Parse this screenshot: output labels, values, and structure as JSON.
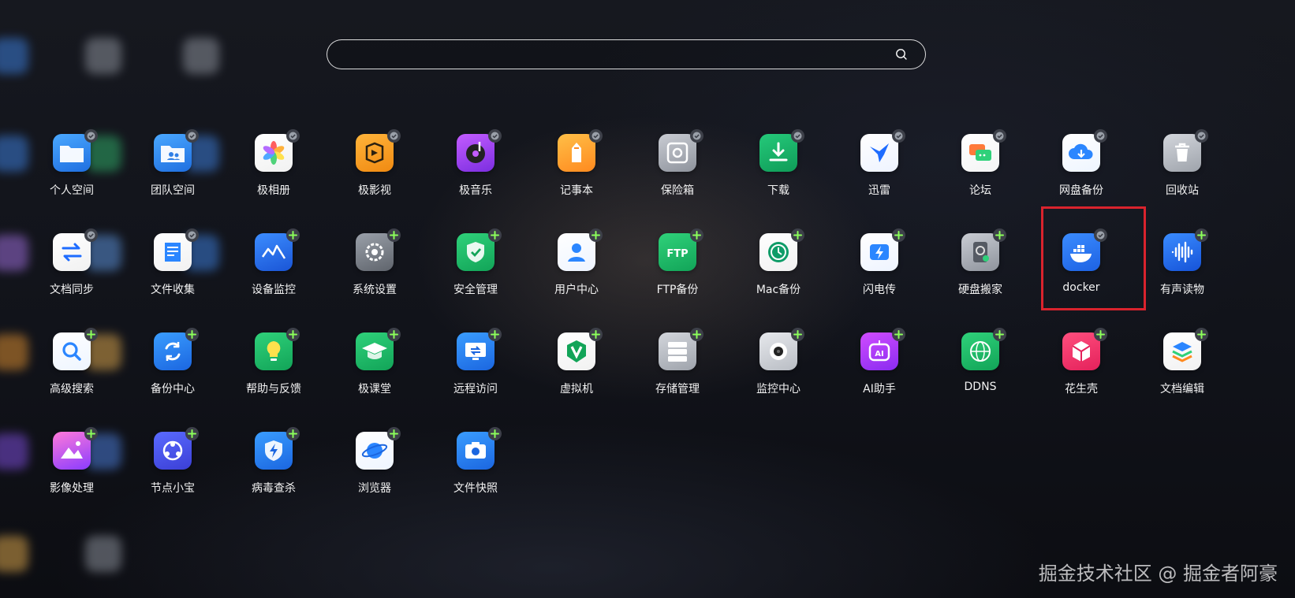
{
  "search": {
    "value": "",
    "placeholder": ""
  },
  "apps": [
    {
      "label": "个人空间",
      "icon": "folder-icon",
      "color1": "#4aa8ff",
      "color2": "#1f6fe0",
      "badge": "installed"
    },
    {
      "label": "团队空间",
      "icon": "team-folder-icon",
      "color1": "#4aa8ff",
      "color2": "#1f6fe0",
      "badge": "installed"
    },
    {
      "label": "极相册",
      "icon": "photos-flower-icon",
      "color1": "#ffffff",
      "color2": "#f1f1f1",
      "badge": "installed"
    },
    {
      "label": "极影视",
      "icon": "video-icon",
      "color1": "#ffb43a",
      "color2": "#f08a12",
      "badge": "installed"
    },
    {
      "label": "极音乐",
      "icon": "music-disc-icon",
      "color1": "#c35cff",
      "color2": "#7b2ee0",
      "badge": "installed"
    },
    {
      "label": "记事本",
      "icon": "notepad-pencil-icon",
      "color1": "#ffbf47",
      "color2": "#ff8a1f",
      "badge": "installed"
    },
    {
      "label": "保险箱",
      "icon": "safe-icon",
      "color1": "#c9ccd3",
      "color2": "#8e939c",
      "badge": "installed"
    },
    {
      "label": "下载",
      "icon": "download-icon",
      "color1": "#25c97a",
      "color2": "#0f9c58",
      "badge": "installed"
    },
    {
      "label": "迅雷",
      "icon": "thunder-bird-icon",
      "color1": "#ffffff",
      "color2": "#eef3ff",
      "badge": "installed"
    },
    {
      "label": "论坛",
      "icon": "forum-chat-icon",
      "color1": "#ffffff",
      "color2": "#f4f4f4",
      "badge": "installed"
    },
    {
      "label": "网盘备份",
      "icon": "cloud-backup-icon",
      "color1": "#ffffff",
      "color2": "#eef5ff",
      "badge": "installed"
    },
    {
      "label": "回收站",
      "icon": "trash-icon",
      "color1": "#d3d6dc",
      "color2": "#9ea3ab",
      "badge": "installed"
    },
    {
      "label": "文档同步",
      "icon": "sync-arrows-icon",
      "color1": "#ffffff",
      "color2": "#f1f1f1",
      "badge": "installed"
    },
    {
      "label": "文件收集",
      "icon": "file-collect-icon",
      "color1": "#ffffff",
      "color2": "#f1f1f1",
      "badge": "installed"
    },
    {
      "label": "设备监控",
      "icon": "device-monitor-icon",
      "color1": "#3c8dff",
      "color2": "#1a55d6",
      "badge": "add"
    },
    {
      "label": "系统设置",
      "icon": "settings-gear-icon",
      "color1": "#9aa0a9",
      "color2": "#5f646c",
      "badge": "add"
    },
    {
      "label": "安全管理",
      "icon": "shield-check-icon",
      "color1": "#2fd17a",
      "color2": "#12a458",
      "badge": "add"
    },
    {
      "label": "用户中心",
      "icon": "user-icon",
      "color1": "#ffffff",
      "color2": "#eef4ff",
      "badge": "add"
    },
    {
      "label": "FTP备份",
      "icon": "ftp-icon",
      "color1": "#2fd17a",
      "color2": "#12a458",
      "badge": "add"
    },
    {
      "label": "Mac备份",
      "icon": "time-machine-icon",
      "color1": "#ffffff",
      "color2": "#f1f1f1",
      "badge": "add"
    },
    {
      "label": "闪电传",
      "icon": "lightning-transfer-icon",
      "color1": "#ffffff",
      "color2": "#eef4ff",
      "badge": "add"
    },
    {
      "label": "硬盘搬家",
      "icon": "disk-move-icon",
      "color1": "#c9ccd3",
      "color2": "#8e939c",
      "badge": "add"
    },
    {
      "label": "docker",
      "icon": "docker-whale-icon",
      "color1": "#3b8cff",
      "color2": "#1d62e3",
      "badge": "installed"
    },
    {
      "label": "有声读物",
      "icon": "audio-wave-icon",
      "color1": "#3a8cff",
      "color2": "#1653d8",
      "badge": "add"
    },
    {
      "label": "高级搜索",
      "icon": "search-magnifier-icon",
      "color1": "#ffffff",
      "color2": "#eef5ff",
      "badge": "add"
    },
    {
      "label": "备份中心",
      "icon": "backup-cycle-icon",
      "color1": "#3a9dff",
      "color2": "#1b66e0",
      "badge": "add"
    },
    {
      "label": "帮助与反馈",
      "icon": "help-bulb-icon",
      "color1": "#2fd17a",
      "color2": "#12a458",
      "badge": "add"
    },
    {
      "label": "极课堂",
      "icon": "graduation-cap-icon",
      "color1": "#2fd17a",
      "color2": "#12a458",
      "badge": "add"
    },
    {
      "label": "远程访问",
      "icon": "remote-access-icon",
      "color1": "#3a9dff",
      "color2": "#1b66e0",
      "badge": "add"
    },
    {
      "label": "虚拟机",
      "icon": "vm-v-icon",
      "color1": "#ffffff",
      "color2": "#f1f1f1",
      "badge": "add"
    },
    {
      "label": "存储管理",
      "icon": "storage-server-icon",
      "color1": "#d3d6dc",
      "color2": "#9ea3ab",
      "badge": "add"
    },
    {
      "label": "监控中心",
      "icon": "camera-monitor-icon",
      "color1": "#e6e8ec",
      "color2": "#b9bdc4",
      "badge": "add"
    },
    {
      "label": "AI助手",
      "icon": "ai-robot-icon",
      "color1": "#d04cff",
      "color2": "#8a2cf0",
      "badge": "add"
    },
    {
      "label": "DDNS",
      "icon": "ddns-globe-icon",
      "color1": "#2fd17a",
      "color2": "#12a458",
      "badge": "add"
    },
    {
      "label": "花生壳",
      "icon": "peanut-cube-icon",
      "color1": "#ff4f7e",
      "color2": "#e4215b",
      "badge": "add"
    },
    {
      "label": "文档编辑",
      "icon": "doc-layers-icon",
      "color1": "#ffffff",
      "color2": "#f1f1f1",
      "badge": "add"
    },
    {
      "label": "影像处理",
      "icon": "image-process-icon",
      "color1": "#ff7ad9",
      "color2": "#8a3cff",
      "badge": "add"
    },
    {
      "label": "节点小宝",
      "icon": "node-link-icon",
      "color1": "#5a6bff",
      "color2": "#3b3fd6",
      "badge": "add"
    },
    {
      "label": "病毒查杀",
      "icon": "antivirus-shield-icon",
      "color1": "#3a9dff",
      "color2": "#1b66e0",
      "badge": "add"
    },
    {
      "label": "浏览器",
      "icon": "browser-planet-icon",
      "color1": "#ffffff",
      "color2": "#eef5ff",
      "badge": "add"
    },
    {
      "label": "文件快照",
      "icon": "snapshot-camera-icon",
      "color1": "#3a9dff",
      "color2": "#1b66e0",
      "badge": "add"
    }
  ],
  "watermark": "掘金技术社区 @ 掘金者阿豪",
  "colors": {
    "highlight": "#d9232d",
    "add_badge": "#8cff5a"
  }
}
